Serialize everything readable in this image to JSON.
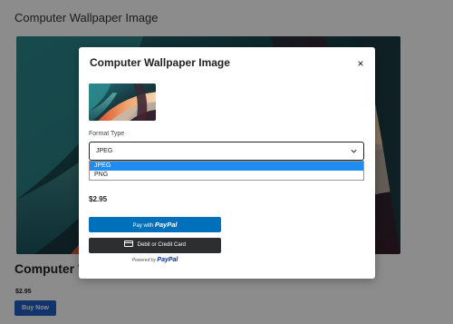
{
  "page": {
    "header": "Computer Wallpaper Image",
    "product_title": "Computer W",
    "price": "$2.95",
    "buy_button": "Buy Now"
  },
  "modal": {
    "title": "Computer Wallpaper Image",
    "close_glyph": "×",
    "thumbnail_icon": "wallpaper-image",
    "format_label": "Format Type",
    "format_selected": "JPEG",
    "format_options": [
      "JPEG",
      "PNG"
    ],
    "price": "$2.95",
    "paypal_button": {
      "prefix": "Pay with",
      "brand": "PayPal"
    },
    "card_button": "Debit or Credit Card",
    "powered_by": {
      "prefix": "Powered by",
      "brand": "PayPal"
    }
  },
  "colors": {
    "overlay": "rgba(0,0,0,0.45)",
    "buy_button": "#2160c4",
    "dropdown_highlight": "#1e8cf0",
    "paypal_blue": "#0070ba",
    "card_button": "#2c2e2f"
  }
}
